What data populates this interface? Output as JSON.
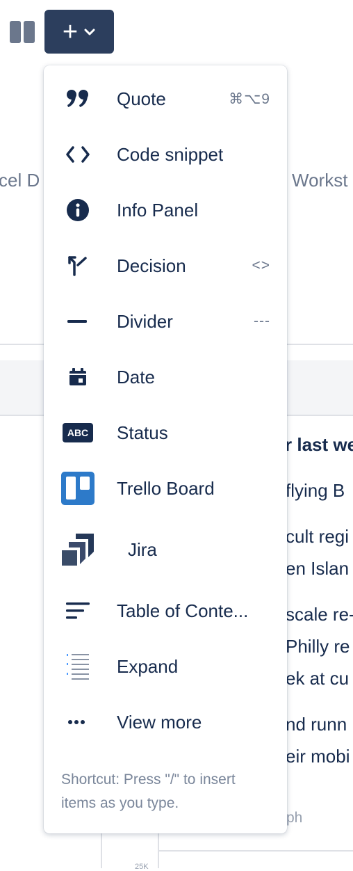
{
  "background": {
    "left_fragment": "cel D",
    "right_fragment": "Workst",
    "right_lines": [
      "r last we",
      "flying B",
      "cult regi",
      "en Islan",
      "scale re-",
      "Philly re",
      "ek at cu",
      "nd runn",
      "eir mobi",
      "ph",
      "25K"
    ]
  },
  "toolbar": {
    "insert_plus": "+",
    "insert_chevron_icon": "chevron-down-icon",
    "layout_icon": "layout-columns-icon"
  },
  "menu": {
    "items": [
      {
        "label": "Quote",
        "shortcut": "⌘⌥9",
        "icon": "quote-icon"
      },
      {
        "label": "Code snippet",
        "shortcut": "",
        "icon": "code-icon"
      },
      {
        "label": "Info Panel",
        "shortcut": "",
        "icon": "info-icon"
      },
      {
        "label": "Decision",
        "shortcut": "<>",
        "icon": "decision-icon"
      },
      {
        "label": "Divider",
        "shortcut": "---",
        "icon": "divider-icon"
      },
      {
        "label": "Date",
        "shortcut": "",
        "icon": "calendar-icon"
      },
      {
        "label": "Status",
        "shortcut": "",
        "icon": "status-icon",
        "badge": "ABC"
      },
      {
        "label": "Trello Board",
        "shortcut": "",
        "icon": "trello-icon"
      },
      {
        "label": "Jira",
        "shortcut": "",
        "icon": "jira-icon"
      },
      {
        "label": "Table of Conte...",
        "shortcut": "",
        "icon": "table-of-contents-icon"
      },
      {
        "label": "Expand",
        "shortcut": "",
        "icon": "expand-icon"
      },
      {
        "label": "View more",
        "shortcut": "",
        "icon": "more-icon"
      }
    ],
    "footer": "Shortcut: Press \"/\" to insert items as you type."
  },
  "colors": {
    "toolbar_button": "#2c3e5d",
    "text": "#172b4d",
    "muted": "#6b778c",
    "trello": "#2d7ac9",
    "jira": "#253858"
  }
}
